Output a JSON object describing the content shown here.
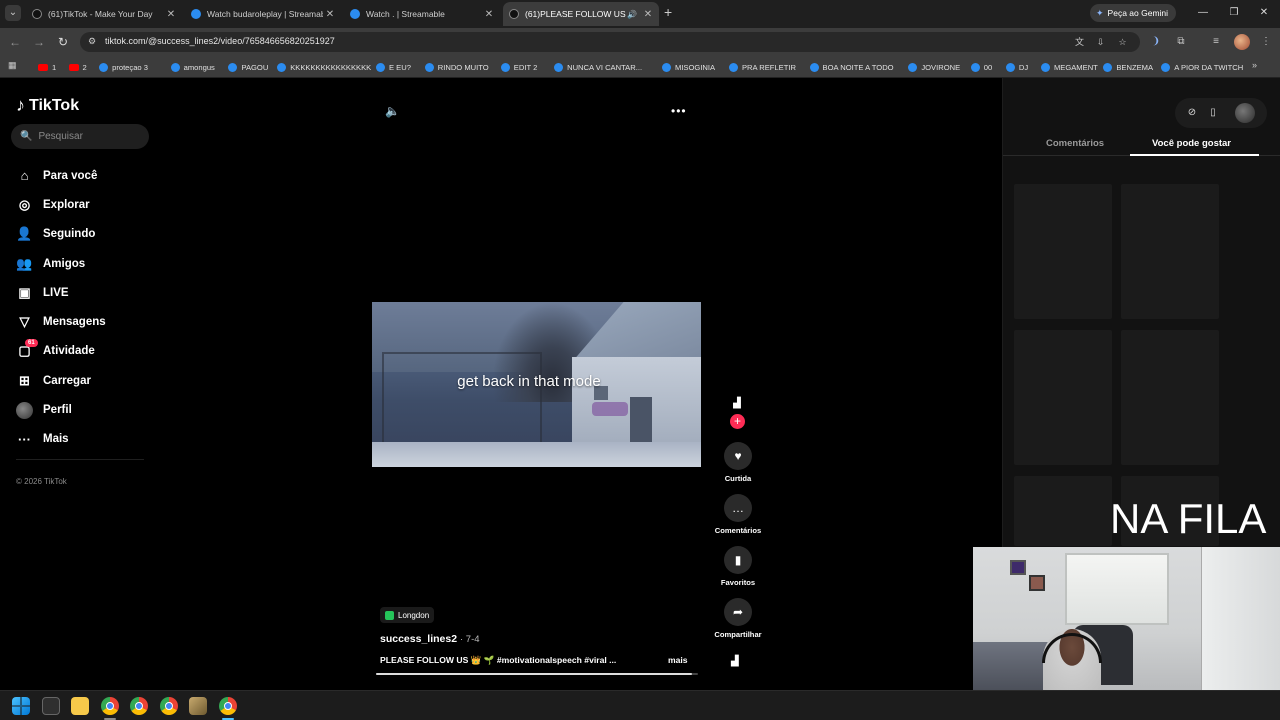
{
  "browser": {
    "tabs": [
      {
        "title": "(61)TikTok - Make Your Day",
        "favicon": "tiktok-icon",
        "active": false
      },
      {
        "title": "Watch budaroleplay | Streamable",
        "favicon": "streamable-icon",
        "active": false
      },
      {
        "title": "Watch . | Streamable",
        "favicon": "streamable-icon",
        "active": false
      },
      {
        "title": "(61)PLEASE FOLLOW US ...",
        "favicon": "tiktok-icon",
        "active": true
      }
    ],
    "gemini_label": "Peça ao Gemini",
    "url": "tiktok.com/@success_lines2/video/7658466568202519​27",
    "bookmarks": [
      {
        "label": "1",
        "icon": "youtube-icon"
      },
      {
        "label": "2",
        "icon": "youtube-icon"
      },
      {
        "label": "proteçao 3",
        "icon": "streamable-icon"
      },
      {
        "label": "amongus",
        "icon": "streamable-icon"
      },
      {
        "label": "PAGOU",
        "icon": "streamable-icon"
      },
      {
        "label": "KKKKKKKKKKKKKKKK",
        "icon": "streamable-icon"
      },
      {
        "label": "E EU?",
        "icon": "streamable-icon"
      },
      {
        "label": "RINDO MUITO",
        "icon": "streamable-icon"
      },
      {
        "label": "EDIT 2",
        "icon": "streamable-icon"
      },
      {
        "label": "NUNCA VI CANTAR...",
        "icon": "streamable-icon"
      },
      {
        "label": "MISOGINIA",
        "icon": "streamable-icon"
      },
      {
        "label": "PRA REFLETIR",
        "icon": "streamable-icon"
      },
      {
        "label": "BOA NOITE A TODO",
        "icon": "streamable-icon"
      },
      {
        "label": "JOVIRONE",
        "icon": "streamable-icon"
      },
      {
        "label": "00",
        "icon": "streamable-icon"
      },
      {
        "label": "DJ",
        "icon": "streamable-icon"
      },
      {
        "label": "MEGAMENT",
        "icon": "streamable-icon"
      },
      {
        "label": "BENZEMA",
        "icon": "streamable-icon"
      },
      {
        "label": "A PIOR DA TWITCH",
        "icon": "streamable-icon"
      }
    ]
  },
  "tiktok": {
    "brand": "TikTok",
    "search_placeholder": "Pesquisar",
    "nav": [
      {
        "label": "Para você",
        "icon": "home-icon"
      },
      {
        "label": "Explorar",
        "icon": "compass-icon"
      },
      {
        "label": "Seguindo",
        "icon": "user-icon"
      },
      {
        "label": "Amigos",
        "icon": "friends-icon"
      },
      {
        "label": "LIVE",
        "icon": "live-icon"
      },
      {
        "label": "Mensagens",
        "icon": "send-icon"
      },
      {
        "label": "Atividade",
        "icon": "inbox-icon",
        "badge": "61"
      },
      {
        "label": "Carregar",
        "icon": "upload-icon"
      },
      {
        "label": "Perfil",
        "icon": "profile-avatar"
      },
      {
        "label": "Mais",
        "icon": "more-icon"
      }
    ],
    "copyright": "© 2026 TikTok",
    "video": {
      "caption": "get back in that mode",
      "music": "Longdon",
      "author": "success_lines2",
      "date": "· 7-4",
      "description": "PLEASE FOLLOW US 👑 🌱 #motivationalspeech #viral ...",
      "more_label": "mais",
      "progress": 0.98
    },
    "actions": [
      {
        "label": "Curtida",
        "icon": "heart-icon"
      },
      {
        "label": "Comentários",
        "icon": "comment-icon"
      },
      {
        "label": "Favoritos",
        "icon": "bookmark-icon"
      },
      {
        "label": "Compartilhar",
        "icon": "share-icon"
      }
    ],
    "right_tabs": [
      "Comentários",
      "Você pode gostar"
    ],
    "active_right_tab": "Você pode gostar"
  },
  "overlay": {
    "queue_text": "NA FILA"
  },
  "colors": {
    "accent": "#fe2c55",
    "background": "#000000",
    "panel": "#121212"
  }
}
